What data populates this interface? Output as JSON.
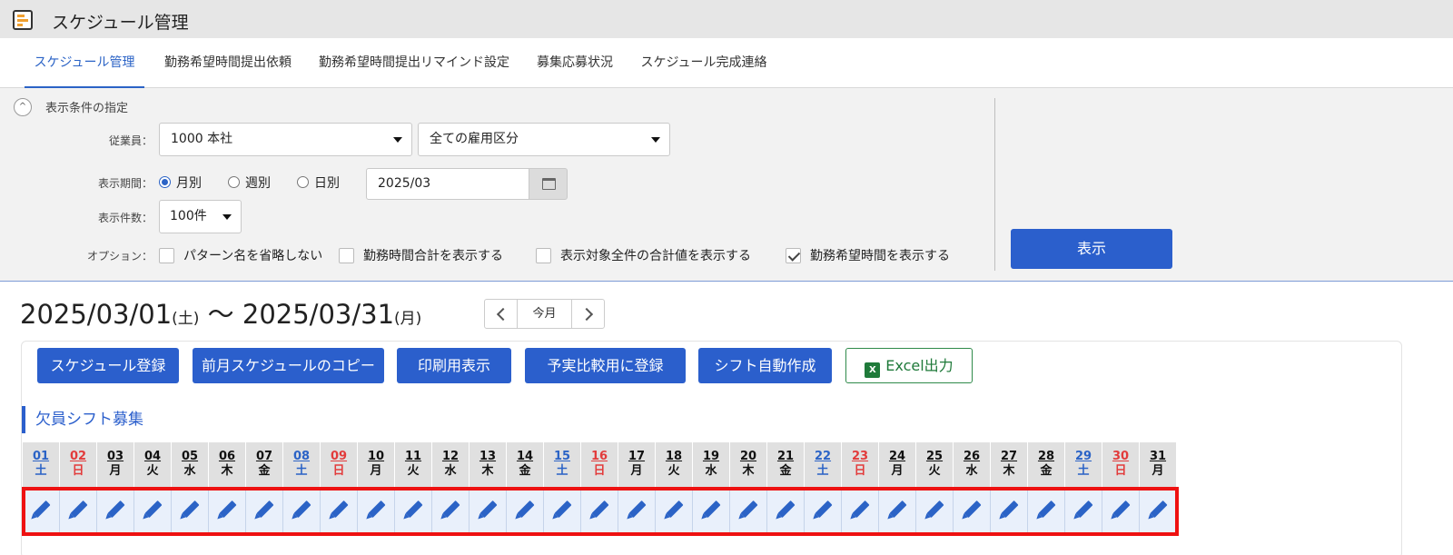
{
  "app": {
    "title": "スケジュール管理"
  },
  "tabs": [
    {
      "label": "スケジュール管理"
    },
    {
      "label": "勤務希望時間提出依頼"
    },
    {
      "label": "勤務希望時間提出リマインド設定"
    },
    {
      "label": "募集応募状況"
    },
    {
      "label": "スケジュール完成連絡"
    }
  ],
  "conditions": {
    "section_label": "表示条件の指定",
    "employee_label": "従業員：",
    "employee_value": "1000 本社",
    "employment_value": "全ての雇用区分",
    "period_label": "表示期間：",
    "period_options": [
      "月別",
      "週別",
      "日別"
    ],
    "period_selected": "月別",
    "date_value": "2025/03",
    "count_label": "表示件数：",
    "count_value": "100件",
    "options_label": "オプション：",
    "options": [
      {
        "label": "パターン名を省略しない",
        "checked": false
      },
      {
        "label": "勤務時間合計を表示する",
        "checked": false
      },
      {
        "label": "表示対象全件の合計値を表示する",
        "checked": false
      },
      {
        "label": "勤務希望時間を表示する",
        "checked": true
      }
    ],
    "show_button": "表示"
  },
  "period": {
    "start": "2025/03/01",
    "start_dow": "(土)",
    "separator": "〜",
    "end": "2025/03/31",
    "end_dow": "(月)",
    "today_button": "今月"
  },
  "actions": [
    {
      "label": "スケジュール登録"
    },
    {
      "label": "前月スケジュールのコピー"
    },
    {
      "label": "印刷用表示"
    },
    {
      "label": "予実比較用に登録"
    },
    {
      "label": "シフト自動作成"
    },
    {
      "label": "Excel出力",
      "icon": "excel-icon"
    }
  ],
  "vacancy": {
    "title": "欠員シフト募集",
    "days": [
      {
        "d": "01",
        "w": "土"
      },
      {
        "d": "02",
        "w": "日"
      },
      {
        "d": "03",
        "w": "月"
      },
      {
        "d": "04",
        "w": "火"
      },
      {
        "d": "05",
        "w": "水"
      },
      {
        "d": "06",
        "w": "木"
      },
      {
        "d": "07",
        "w": "金"
      },
      {
        "d": "08",
        "w": "土"
      },
      {
        "d": "09",
        "w": "日"
      },
      {
        "d": "10",
        "w": "月"
      },
      {
        "d": "11",
        "w": "火"
      },
      {
        "d": "12",
        "w": "水"
      },
      {
        "d": "13",
        "w": "木"
      },
      {
        "d": "14",
        "w": "金"
      },
      {
        "d": "15",
        "w": "土"
      },
      {
        "d": "16",
        "w": "日"
      },
      {
        "d": "17",
        "w": "月"
      },
      {
        "d": "18",
        "w": "火"
      },
      {
        "d": "19",
        "w": "水"
      },
      {
        "d": "20",
        "w": "木"
      },
      {
        "d": "21",
        "w": "金"
      },
      {
        "d": "22",
        "w": "土"
      },
      {
        "d": "23",
        "w": "日"
      },
      {
        "d": "24",
        "w": "月"
      },
      {
        "d": "25",
        "w": "火"
      },
      {
        "d": "26",
        "w": "水"
      },
      {
        "d": "27",
        "w": "木"
      },
      {
        "d": "28",
        "w": "金"
      },
      {
        "d": "29",
        "w": "土"
      },
      {
        "d": "30",
        "w": "日"
      },
      {
        "d": "31",
        "w": "月"
      }
    ]
  },
  "colors": {
    "accent": "#2b5fcc",
    "saturday": "#2b63c6",
    "sunday": "#e23b3b",
    "highlight": "#ee1111"
  }
}
